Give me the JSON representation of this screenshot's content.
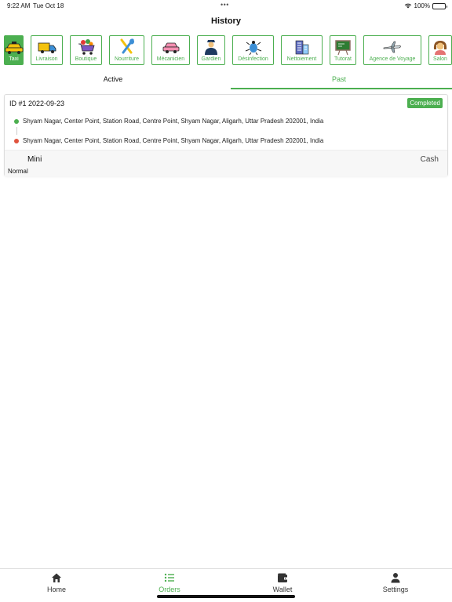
{
  "status_bar": {
    "time": "9:22 AM",
    "date": "Tue Oct 18",
    "battery": "100%"
  },
  "header": {
    "title": "History"
  },
  "categories": [
    {
      "label": "Taxi",
      "icon": "taxi-icon",
      "active": true
    },
    {
      "label": "Livraison",
      "icon": "truck-icon",
      "active": false
    },
    {
      "label": "Boutique",
      "icon": "shopping-cart-icon",
      "active": false
    },
    {
      "label": "Nourriture",
      "icon": "fork-knife-icon",
      "active": false
    },
    {
      "label": "Mécanicien",
      "icon": "car-repair-icon",
      "active": false
    },
    {
      "label": "Gardien",
      "icon": "guard-icon",
      "active": false
    },
    {
      "label": "Désinfection",
      "icon": "disinfection-spray-icon",
      "active": false
    },
    {
      "label": "Nettoiement",
      "icon": "building-icon",
      "active": false
    },
    {
      "label": "Tutorat",
      "icon": "chalkboard-icon",
      "active": false
    },
    {
      "label": "Agence de Voyage",
      "icon": "airplane-icon",
      "active": false
    },
    {
      "label": "Salon",
      "icon": "woman-hair-icon",
      "active": false
    }
  ],
  "tabs": {
    "active": "Active",
    "past": "Past"
  },
  "orders": [
    {
      "id": "ID #1 2022-09-23",
      "status": "Completed",
      "pickup": "Shyam Nagar, Center Point, Station Road, Centre Point, Shyam Nagar, Aligarh, Uttar Pradesh 202001, India",
      "dropoff": "Shyam Nagar, Center Point, Station Road, Centre Point, Shyam Nagar, Aligarh, Uttar Pradesh 202001, India",
      "vehicle": "Mini",
      "payment": "Cash",
      "type": "Normal"
    }
  ],
  "bottom_nav": {
    "home": "Home",
    "orders": "Orders",
    "wallet": "Wallet",
    "settings": "Settings"
  },
  "colors": {
    "accent": "#4caf50",
    "pickup_dot": "#4caf50",
    "dropoff_dot": "#e0533d"
  }
}
